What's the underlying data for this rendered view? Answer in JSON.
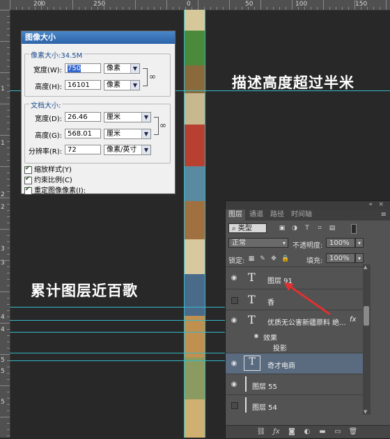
{
  "rulers": {
    "top_labels": [
      "200",
      "250",
      "0",
      "50",
      "100",
      "150",
      "200"
    ],
    "left_labels": [
      "1",
      "1",
      "2",
      "2",
      "3",
      "3",
      "4",
      "4",
      "5",
      "5",
      "5"
    ]
  },
  "overlay": {
    "height_note": "描述高度超过半米",
    "layers_note": "累计图层近百歌"
  },
  "image_size_dialog": {
    "title": "图像大小",
    "pixel_dimensions": {
      "group_title": "像素大小:34.5M",
      "width_label": "宽度(W):",
      "width_value": "750",
      "width_unit": "像素",
      "height_label": "高度(H):",
      "height_value": "16101",
      "height_unit": "像素"
    },
    "document_size": {
      "group_title": "文档大小:",
      "width_label": "宽度(D):",
      "width_value": "26.46",
      "width_unit": "厘米",
      "height_label": "高度(G):",
      "height_value": "568.01",
      "height_unit": "厘米",
      "resolution_label": "分辨率(R):",
      "resolution_value": "72",
      "resolution_unit": "像素/英寸"
    },
    "options": {
      "scale_styles": "缩放样式(Y)",
      "constrain": "约束比例(C)",
      "resample": "重定图像像素(I):"
    }
  },
  "layers_panel": {
    "tabs": [
      "图层",
      "通道",
      "路径",
      "时间轴"
    ],
    "filter_kind": "类型",
    "blend_mode": "正常",
    "opacity_label": "不透明度:",
    "opacity_value": "100%",
    "lock_label": "锁定:",
    "fill_label": "填充:",
    "fill_value": "100%",
    "layers": [
      {
        "name": "图层 91",
        "type_icon": "T",
        "visible": true
      },
      {
        "name": "香",
        "type_icon": "T",
        "visible": false
      },
      {
        "name": "优质无公害新疆原料 绝...",
        "type_icon": "T",
        "visible": true,
        "fx": "fx"
      },
      {
        "name": "效果",
        "sub": true
      },
      {
        "name": "投影",
        "sub": true
      },
      {
        "name": "奇才电商",
        "type_icon": "T",
        "visible": true,
        "selected": true
      },
      {
        "name": "图层 55",
        "visible": true
      },
      {
        "name": "图层 54",
        "visible": false
      }
    ]
  },
  "colors": {
    "canvas": "#282828",
    "guide": "#35b8c8",
    "selected_layer": "#5a6b80",
    "annotation_arrow": "#e03030"
  }
}
